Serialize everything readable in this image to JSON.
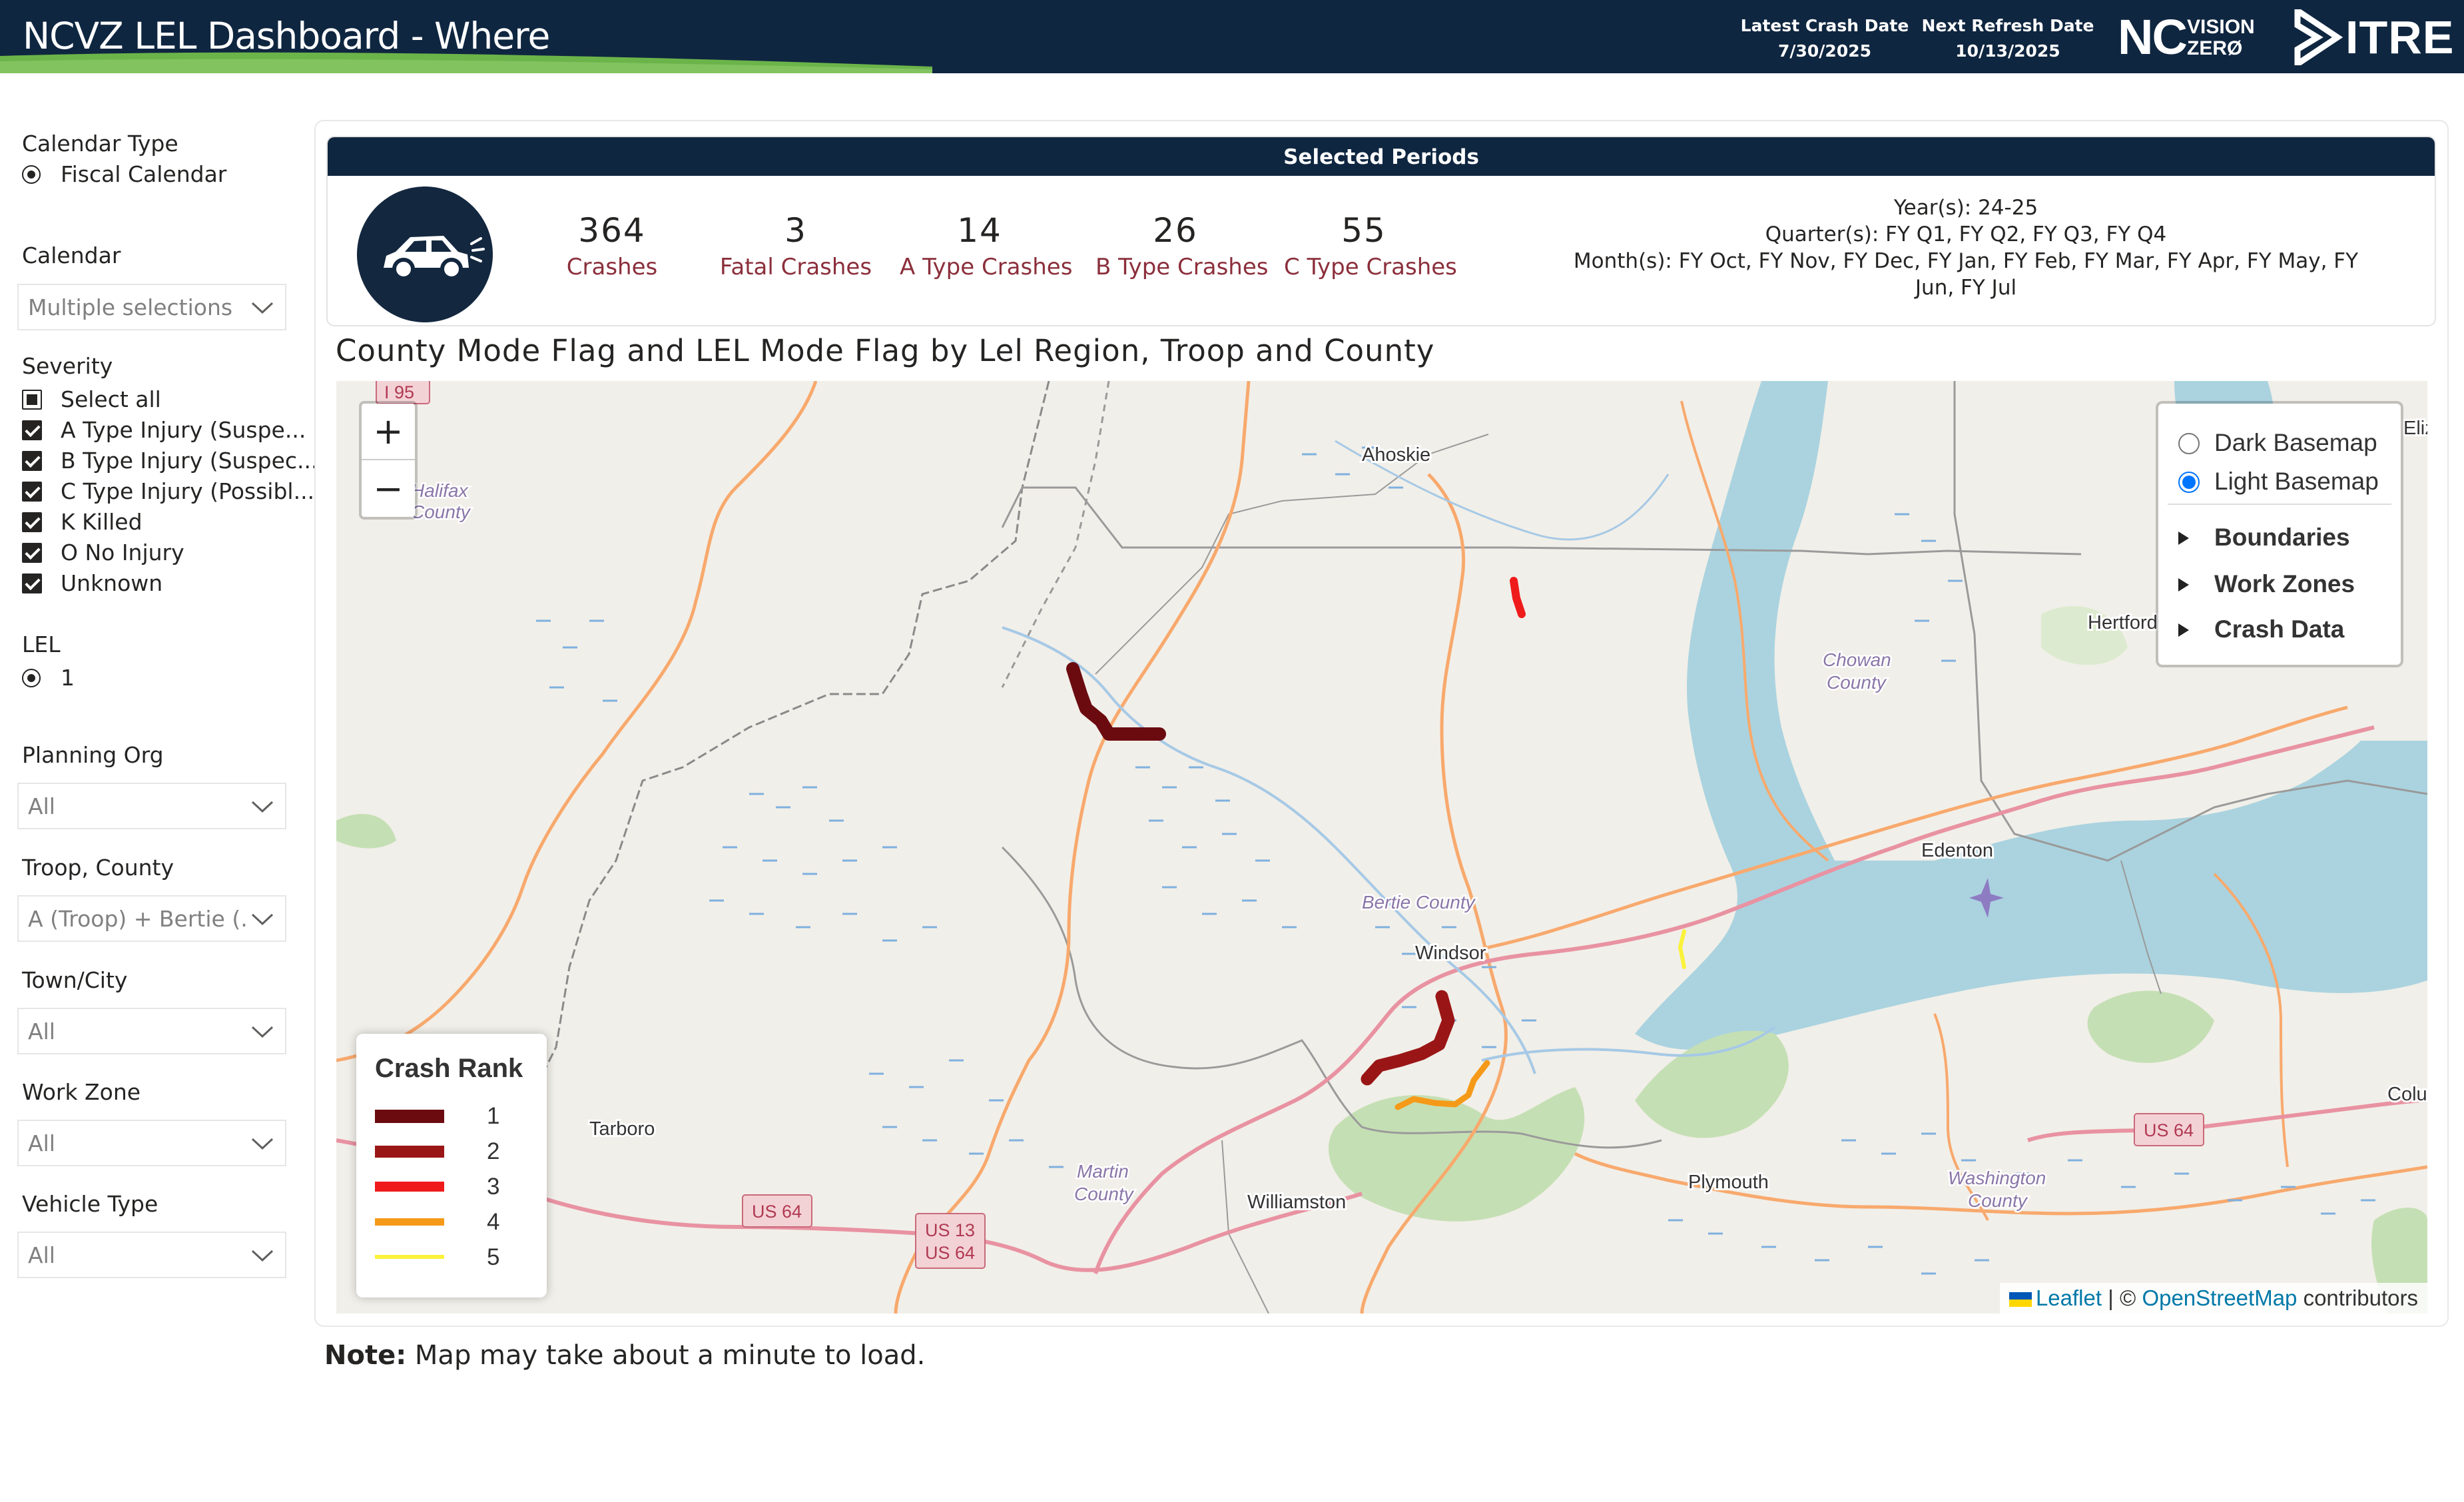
{
  "header": {
    "title": "NCVZ LEL Dashboard - Where",
    "latest_crash_label": "Latest Crash Date",
    "latest_crash_value": "7/30/2025",
    "next_refresh_label": "Next Refresh Date",
    "next_refresh_value": "10/13/2025",
    "logo_nc": "NC",
    "logo_vision": "VISION",
    "logo_zero": "ZERØ",
    "logo_itre": "ITRE",
    "colors": {
      "header_bg": "#0f2640",
      "swoosh": "#6bb44a"
    }
  },
  "sidebar": {
    "calendar_type": {
      "label": "Calendar Type",
      "option": "Fiscal Calendar"
    },
    "calendar": {
      "label": "Calendar",
      "value": "Multiple selections"
    },
    "severity": {
      "label": "Severity",
      "select_all": "Select all",
      "options": [
        "A Type Injury (Suspe...",
        "B Type Injury (Suspec...",
        "C Type Injury (Possibl...",
        "K Killed",
        "O No Injury",
        "Unknown"
      ]
    },
    "lel": {
      "label": "LEL",
      "option": "1"
    },
    "planning_org": {
      "label": "Planning Org",
      "value": "All"
    },
    "troop_county": {
      "label": "Troop, County",
      "value": "A (Troop) + Bertie (..."
    },
    "town_city": {
      "label": "Town/City",
      "value": "All"
    },
    "work_zone": {
      "label": "Work Zone",
      "value": "All"
    },
    "vehicle_type": {
      "label": "Vehicle Type",
      "value": "All"
    }
  },
  "periods": {
    "header": "Selected Periods",
    "icon": "car-crash-icon",
    "kpis": [
      {
        "value": "364",
        "label": "Crashes"
      },
      {
        "value": "3",
        "label": "Fatal Crashes"
      },
      {
        "value": "14",
        "label": "A Type Crashes"
      },
      {
        "value": "26",
        "label": "B Type Crashes"
      },
      {
        "value": "55",
        "label": "C Type Crashes"
      }
    ],
    "years": "Year(s): 24-25",
    "quarters": "Quarter(s): FY Q1, FY Q2, FY Q3, FY Q4",
    "months": "Month(s): FY Oct, FY Nov, FY Dec, FY Jan, FY Feb, FY Mar, FY Apr, FY May, FY Jun, FY Jul",
    "kpi_label_color": "#8b2f3b"
  },
  "map": {
    "title": "County Mode Flag and LEL Mode Flag by Lel Region, Troop and County",
    "zoom_in": "+",
    "zoom_out": "−",
    "basemaps": [
      "Dark Basemap",
      "Light Basemap"
    ],
    "selected_basemap": "Light Basemap",
    "overlay_groups": [
      "Boundaries",
      "Work Zones",
      "Crash Data"
    ],
    "place_labels": {
      "ahoskie": "Ahoskie",
      "windsor": "Windsor",
      "edenton": "Edenton",
      "hertford": "Hertford",
      "tarboro": "Tarboro",
      "williamston": "Williamston",
      "plymouth": "Plymouth",
      "colu": "Colu",
      "eliz": "Eliz",
      "chowan_1": "Chowan",
      "chowan_2": "County",
      "bertie": "Bertie County",
      "martin_1": "Martin",
      "martin_2": "County",
      "washington_1": "Washington",
      "washington_2": "County",
      "halifax_1": "Halifax",
      "halifax_2": "County",
      "shield_i95": "I 95",
      "shield_us64_a": "US 64",
      "shield_us13": "US 13",
      "shield_us64_b": "US 64",
      "shield_us64_c": "US 64"
    },
    "legend": {
      "title": "Crash Rank",
      "items": [
        {
          "label": "1",
          "color": "#6b0b10"
        },
        {
          "label": "2",
          "color": "#9a1616"
        },
        {
          "label": "3",
          "color": "#ef1b1b"
        },
        {
          "label": "4",
          "color": "#f59a18"
        },
        {
          "label": "5",
          "color": "#fbf23a"
        }
      ]
    },
    "attribution": {
      "leaflet": "Leaflet",
      "separator": "| ©",
      "osm": "OpenStreetMap",
      "suffix": "contributors"
    }
  },
  "note": {
    "bold": "Note:",
    "text": "Map may take about a minute to load."
  }
}
